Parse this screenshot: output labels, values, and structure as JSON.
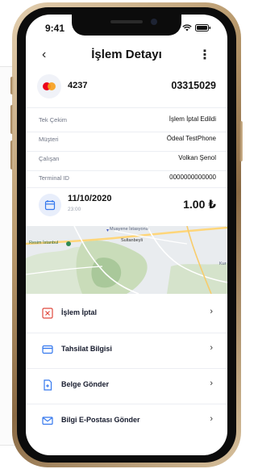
{
  "status_bar": {
    "time": "9:41"
  },
  "header": {
    "back": "‹",
    "title": "İşlem Detayı",
    "more": "⋮"
  },
  "card": {
    "last4": "4237",
    "order_no": "03315029"
  },
  "details": [
    {
      "label": "Tek Çekim",
      "value": "İşlem İptal Edildi"
    },
    {
      "label": "Müşteri",
      "value": "Ödeal TestPhone"
    },
    {
      "label": "Çalışan",
      "value": "Volkan Şenol"
    },
    {
      "label": "Terminal ID",
      "value": "0000000000000"
    }
  ],
  "transaction": {
    "date": "11/10/2020",
    "time": "23:00",
    "amount": "1.00 ₺"
  },
  "map": {
    "labels": [
      "Muayene İstasyonu",
      "Sultanbeyli",
      "Resim İstanbul",
      "Kur"
    ]
  },
  "actions": [
    {
      "label": "İşlem İptal",
      "icon": "cancel-icon",
      "color": "#e0493e",
      "chevron": "›"
    },
    {
      "label": "Tahsilat Bilgisi",
      "icon": "card-icon",
      "color": "#3478ee",
      "chevron": "›"
    },
    {
      "label": "Belge Gönder",
      "icon": "document-icon",
      "color": "#3478ee",
      "chevron": "›"
    },
    {
      "label": "Bilgi E-Postası Gönder",
      "icon": "mail-icon",
      "color": "#3478ee",
      "chevron": "›"
    }
  ]
}
